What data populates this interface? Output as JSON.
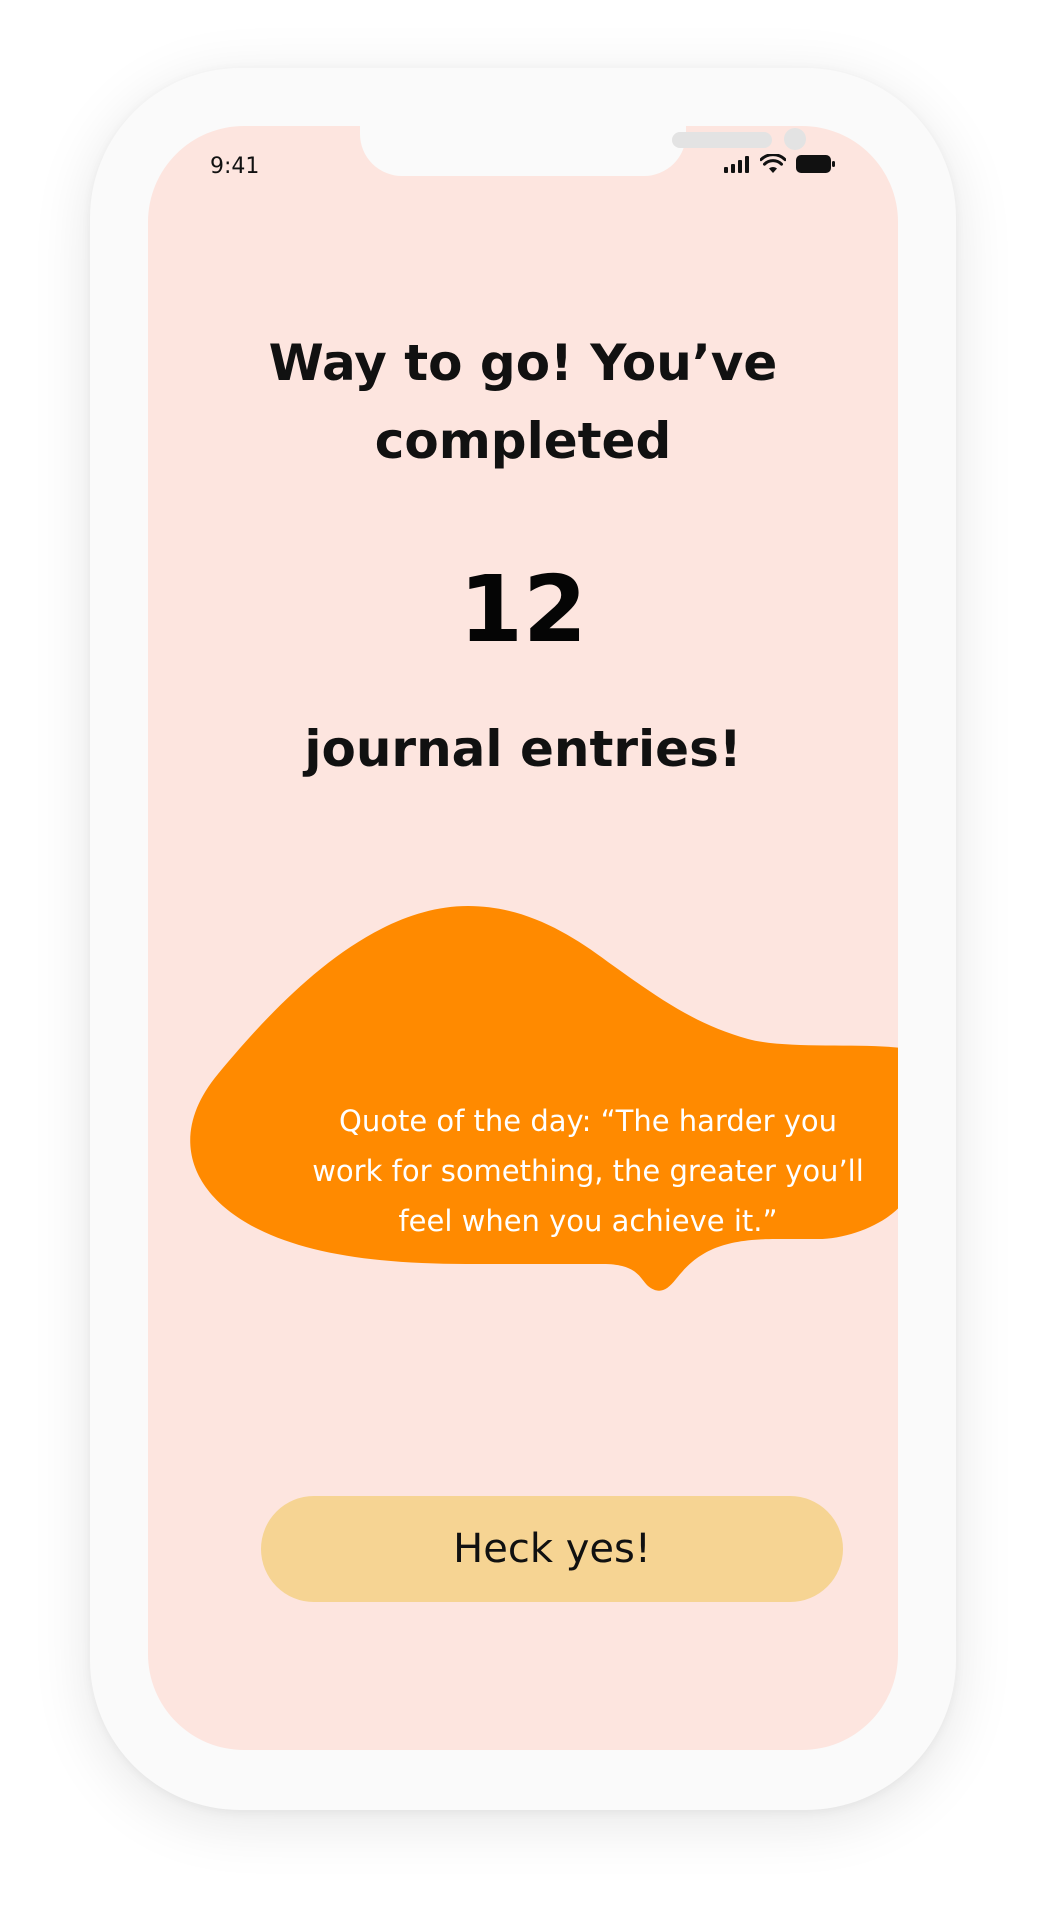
{
  "status_bar": {
    "time": "9:41",
    "icons": [
      "cellular-signal-icon",
      "wifi-icon",
      "battery-icon"
    ]
  },
  "celebration": {
    "headline": "Way to go! You’ve completed",
    "count": "12",
    "subtitle": "journal entries!"
  },
  "quote_card": {
    "text": "Quote of the day: “The harder you work for something, the greater you’ll feel when you achieve it.”"
  },
  "cta": {
    "label": "Heck yes!"
  },
  "colors": {
    "screen_background": "#fde5df",
    "blob": "#ff8a00",
    "button": "#f6d493",
    "text": "#111111"
  }
}
